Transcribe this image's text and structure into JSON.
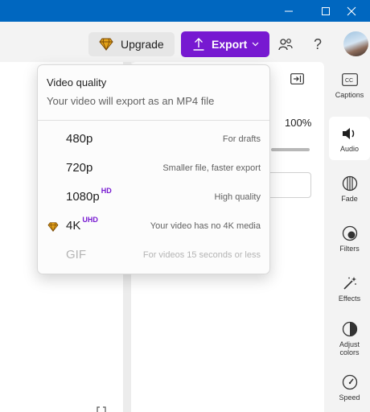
{
  "window": {
    "minimize_icon": "minimize-icon",
    "maximize_icon": "maximize-icon",
    "close_icon": "close-icon",
    "titlebar_color": "#0067c0"
  },
  "toolbar": {
    "upgrade_label": "Upgrade",
    "export_label": "Export",
    "accent_color": "#7719d1"
  },
  "panel": {
    "volume_value": "100%"
  },
  "rail": {
    "items": [
      {
        "label": "Captions",
        "icon": "captions-icon"
      },
      {
        "label": "Audio",
        "icon": "speaker-icon"
      },
      {
        "label": "Fade",
        "icon": "fade-icon"
      },
      {
        "label": "Filters",
        "icon": "filters-icon"
      },
      {
        "label": "Effects",
        "icon": "magic-wand-icon"
      },
      {
        "label": "Adjust",
        "label2": "colors",
        "icon": "contrast-icon"
      },
      {
        "label": "Speed",
        "icon": "speedometer-icon"
      }
    ]
  },
  "dropdown": {
    "title": "Video quality",
    "subtitle": "Your video will export as an MP4 file",
    "options": [
      {
        "name": "480p",
        "badge": "",
        "desc": "For drafts",
        "premium": false,
        "disabled": false
      },
      {
        "name": "720p",
        "badge": "",
        "desc": "Smaller file, faster export",
        "premium": false,
        "disabled": false
      },
      {
        "name": "1080p",
        "badge": "HD",
        "desc": "High quality",
        "premium": false,
        "disabled": false
      },
      {
        "name": "4K",
        "badge": "UHD",
        "desc": "Your video has no 4K media",
        "premium": true,
        "disabled": false
      },
      {
        "name": "GIF",
        "badge": "",
        "desc": "For videos 15 seconds or less",
        "premium": false,
        "disabled": true
      }
    ]
  }
}
